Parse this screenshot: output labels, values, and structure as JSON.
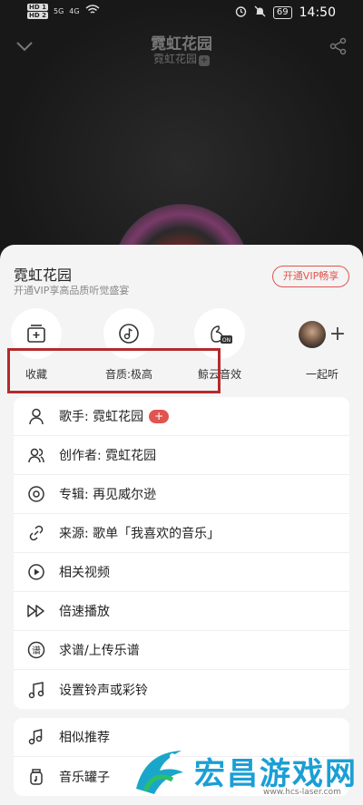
{
  "status_bar": {
    "hd1": "HD 1",
    "hd2": "HD 2",
    "net1": "5G",
    "net2": "4G",
    "battery": "69",
    "time": "14:50"
  },
  "player": {
    "title": "霓虹花园",
    "artist": "霓虹花园",
    "artist_badge": "+"
  },
  "sheet": {
    "title": "霓虹花园",
    "subtitle": "开通VIP享高品质听觉盛宴",
    "vip_button": "开通VIP畅享"
  },
  "actions": [
    {
      "label": "收藏",
      "icon": "add-to-collection-icon"
    },
    {
      "label": "音质:极高",
      "icon": "sound-quality-icon"
    },
    {
      "label": "鲸云音效",
      "icon": "whale-sound-effect-icon"
    },
    {
      "label": "一起听",
      "icon": "listen-together-icon",
      "plus": "+"
    }
  ],
  "menu_main": [
    {
      "label": "歌手: 霓虹花园",
      "icon": "person-icon",
      "badge": "+"
    },
    {
      "label": "创作者: 霓虹花园",
      "icon": "people-icon"
    },
    {
      "label": "专辑: 再见威尔逊",
      "icon": "album-icon"
    },
    {
      "label": "来源: 歌单「我喜欢的音乐」",
      "icon": "link-icon"
    },
    {
      "label": "相关视频",
      "icon": "video-icon"
    },
    {
      "label": "倍速播放",
      "icon": "speed-play-icon"
    },
    {
      "label": "求谱/上传乐谱",
      "icon": "score-icon"
    },
    {
      "label": "设置铃声或彩铃",
      "icon": "ringtone-icon"
    }
  ],
  "menu_secondary": [
    {
      "label": "相似推荐",
      "icon": "similar-icon"
    },
    {
      "label": "音乐罐子",
      "icon": "music-jar-icon"
    }
  ],
  "watermark": {
    "text": "宏昌游戏网",
    "url": "www.hcs-laser.com"
  },
  "colors": {
    "accent": "#e0554f",
    "highlight_box": "#b52a2a",
    "watermark_blue": "#1a9fd5"
  }
}
